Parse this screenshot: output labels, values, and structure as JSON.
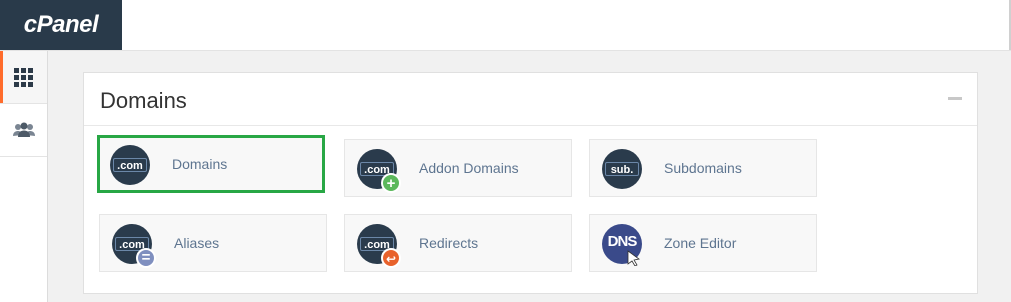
{
  "brand": {
    "logo_text": "cPanel"
  },
  "sidebar": {
    "items": [
      {
        "icon": "grid-icon",
        "active": true
      },
      {
        "icon": "users-icon",
        "active": false
      }
    ]
  },
  "panel": {
    "title": "Domains",
    "tiles": [
      {
        "label": "Domains",
        "icon": "domains-icon",
        "badge": ".com",
        "highlighted": true
      },
      {
        "label": "Addon Domains",
        "icon": "addon-domains-icon",
        "badge": ".com",
        "overlay": "plus",
        "overlay_color": "#5cb85c"
      },
      {
        "label": "Subdomains",
        "icon": "subdomains-icon",
        "badge": "sub."
      },
      {
        "label": "Aliases",
        "icon": "aliases-icon",
        "badge": ".com",
        "overlay": "equals",
        "overlay_color": "#7f8fbf"
      },
      {
        "label": "Redirects",
        "icon": "redirects-icon",
        "badge": ".com",
        "overlay": "redirect",
        "overlay_color": "#e8622c"
      },
      {
        "label": "Zone Editor",
        "icon": "zone-editor-icon",
        "badge": "DNS"
      }
    ]
  },
  "colors": {
    "accent_orange": "#ff6c2c",
    "highlight_green": "#28a745",
    "icon_navy": "#2a3b4c",
    "label_blue": "#5e7590"
  }
}
